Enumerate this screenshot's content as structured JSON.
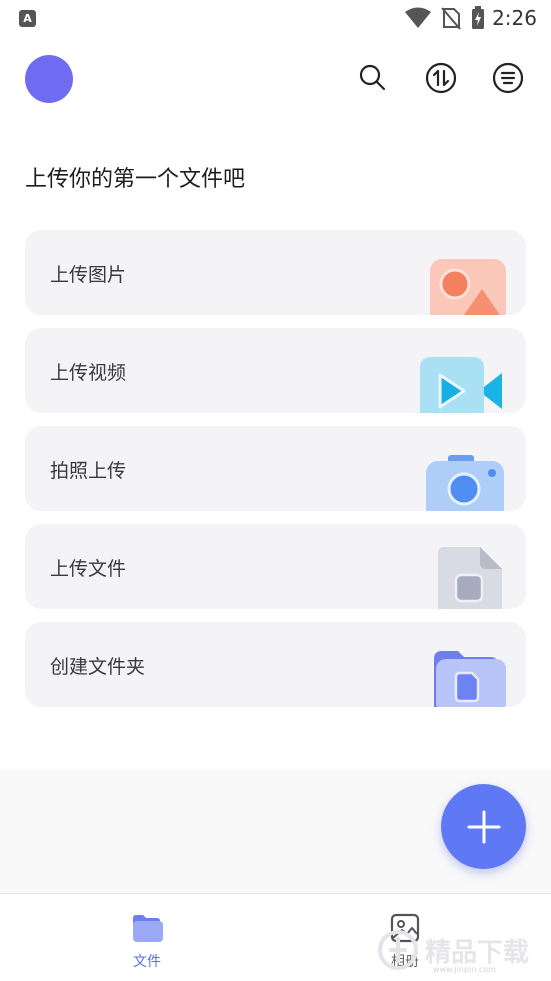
{
  "status_bar": {
    "left_badge": "A",
    "time": "2:26",
    "icons": [
      "wifi-icon",
      "no-sim-icon",
      "battery-charging-icon"
    ]
  },
  "header": {
    "avatar_color": "#6f6cf2",
    "actions": [
      "search-icon",
      "transfer-icon",
      "menu-icon"
    ]
  },
  "page": {
    "title": "上传你的第一个文件吧"
  },
  "cards": [
    {
      "label": "上传图片",
      "icon": "image-icon"
    },
    {
      "label": "上传视频",
      "icon": "video-icon"
    },
    {
      "label": "拍照上传",
      "icon": "camera-icon"
    },
    {
      "label": "上传文件",
      "icon": "file-icon"
    },
    {
      "label": "创建文件夹",
      "icon": "folder-icon"
    }
  ],
  "fab": {
    "icon": "plus-icon",
    "color": "#5f79f5"
  },
  "bottom_nav": {
    "items": [
      {
        "label": "文件",
        "icon": "folder-icon",
        "active": true
      },
      {
        "label": "相册",
        "icon": "album-icon",
        "active": false
      }
    ],
    "active_color": "#5a6fe0",
    "inactive_color": "#666666"
  },
  "watermark": {
    "text": "精品下载",
    "url_text": "www.jinpin.com"
  }
}
